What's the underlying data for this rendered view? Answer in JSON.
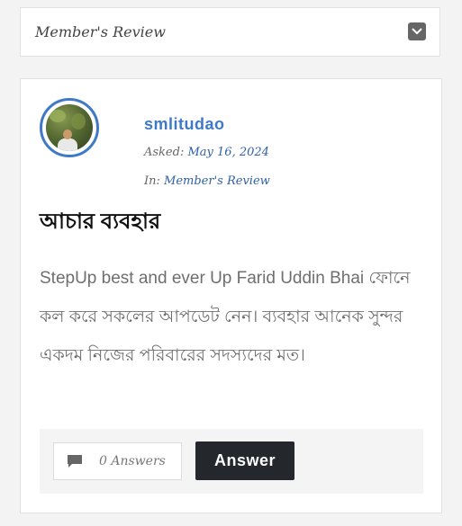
{
  "category": {
    "label": "Member's Review",
    "toggle_icon": "chevron-down-icon"
  },
  "question": {
    "username": "smlitudao",
    "asked_label": "Asked:",
    "asked_date": "May 16, 2024",
    "in_label": "In:",
    "in_category": "Member's Review",
    "title": "আচার ব্যবহার",
    "body": "StepUp best and ever Up Farid Uddin Bhai ফোনে কল করে সকলের আপডেট নেন।  ব্যবহার আনেক সুন্দর একদম নিজের পরিবারের সদস্যদের মত।"
  },
  "footer": {
    "answers_count": "0 Answers",
    "answer_button": "Answer",
    "comment_icon": "comment-icon"
  },
  "colors": {
    "accent": "#3f79c7",
    "button_bg": "#24272c"
  }
}
